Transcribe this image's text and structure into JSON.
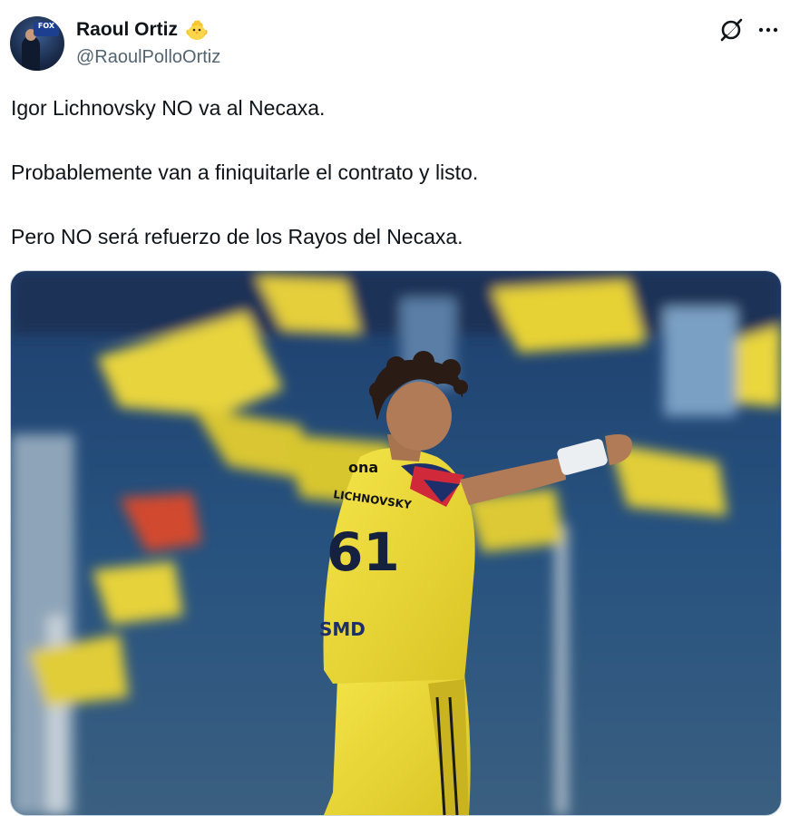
{
  "author": {
    "display_name": "Raoul Ortiz",
    "handle": "@RaoulPolloOrtiz",
    "badge_emoji": "🐥",
    "avatar_text": "FOX"
  },
  "header": {
    "grok_icon": "grok-icon",
    "more_icon": "more-horizontal-icon"
  },
  "tweet": {
    "paragraphs": [
      "Igor Lichnovsky NO va al Necaxa.",
      "Probablemente van a finiquitarle el contrato y listo.",
      "Pero NO será refuerzo de los Rayos del Necaxa."
    ]
  },
  "media": {
    "jersey_text": "ona",
    "jersey_name": "LICHNOVSKY",
    "jersey_number": "61",
    "sponsor_text": "SMD"
  },
  "colors": {
    "text": "#0f1419",
    "secondary": "#536471",
    "jersey_yellow": "#f2e03a"
  }
}
